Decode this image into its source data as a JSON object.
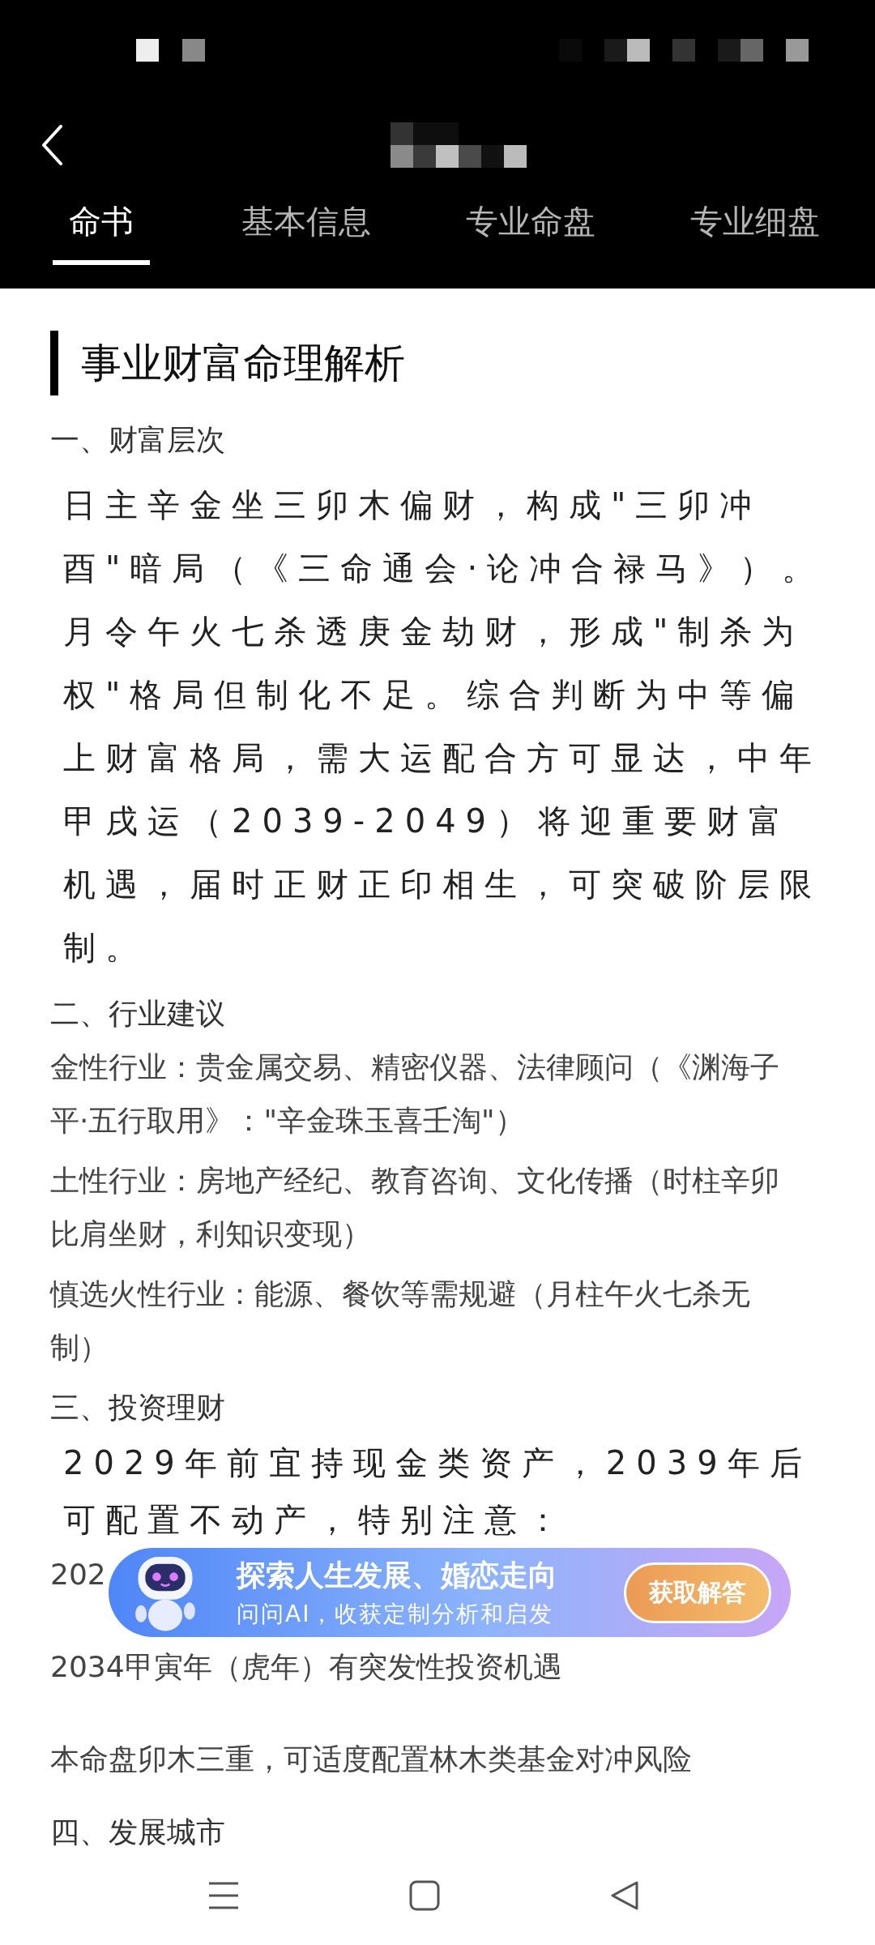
{
  "tabs": [
    {
      "label": "命书",
      "selected": true
    },
    {
      "label": "基本信息",
      "selected": false
    },
    {
      "label": "专业命盘",
      "selected": false
    },
    {
      "label": "专业细盘",
      "selected": false
    }
  ],
  "heading": "事业财富命理解析",
  "sections": [
    {
      "title": "一、财富层次",
      "blocks": [
        {
          "kind": "spaced",
          "text": "日主辛金坐三卯木偏财，构成\"三卯冲酉\"暗局（《三命通会·论冲合禄马》）。月令午火七杀透庚金劫财，形成\"制杀为权\"格局但制化不足。综合判断为中等偏上财富格局，需大运配合方可显达，中年甲戌运（2039-2049）将迎重要财富机遇，届时正财正印相生，可突破阶层限制。"
        }
      ]
    },
    {
      "title": "二、行业建议",
      "blocks": [
        {
          "kind": "plain",
          "text": "金性行业：贵金属交易、精密仪器、法律顾问（《渊海子平·五行取用》：\"辛金珠玉喜壬淘\"）"
        },
        {
          "kind": "plain",
          "text": "土性行业：房地产经纪、教育咨询、文化传播（时柱辛卯比肩坐财，利知识变现）"
        },
        {
          "kind": "plain",
          "text": "慎选火性行业：能源、餐饮等需规避（月柱午火七杀无制）"
        }
      ]
    },
    {
      "title": "三、投资理财",
      "blocks": [
        {
          "kind": "spaced",
          "text": "2029年前宜持现金类资产，2039年后可配置不动产，特别注意："
        },
        {
          "kind": "plain",
          "text": "202"
        },
        {
          "kind": "plain",
          "text": "2034甲寅年（虎年）有突发性投资机遇"
        },
        {
          "kind": "plain",
          "text": "本命盘卯木三重，可适度配置林木类基金对冲风险"
        }
      ]
    },
    {
      "title": "四、发展城市"
    }
  ],
  "banner": {
    "title": "探索人生发展、婚恋走向",
    "subtitle": "问问AI，收获定制分析和启发",
    "button": "获取解答"
  }
}
